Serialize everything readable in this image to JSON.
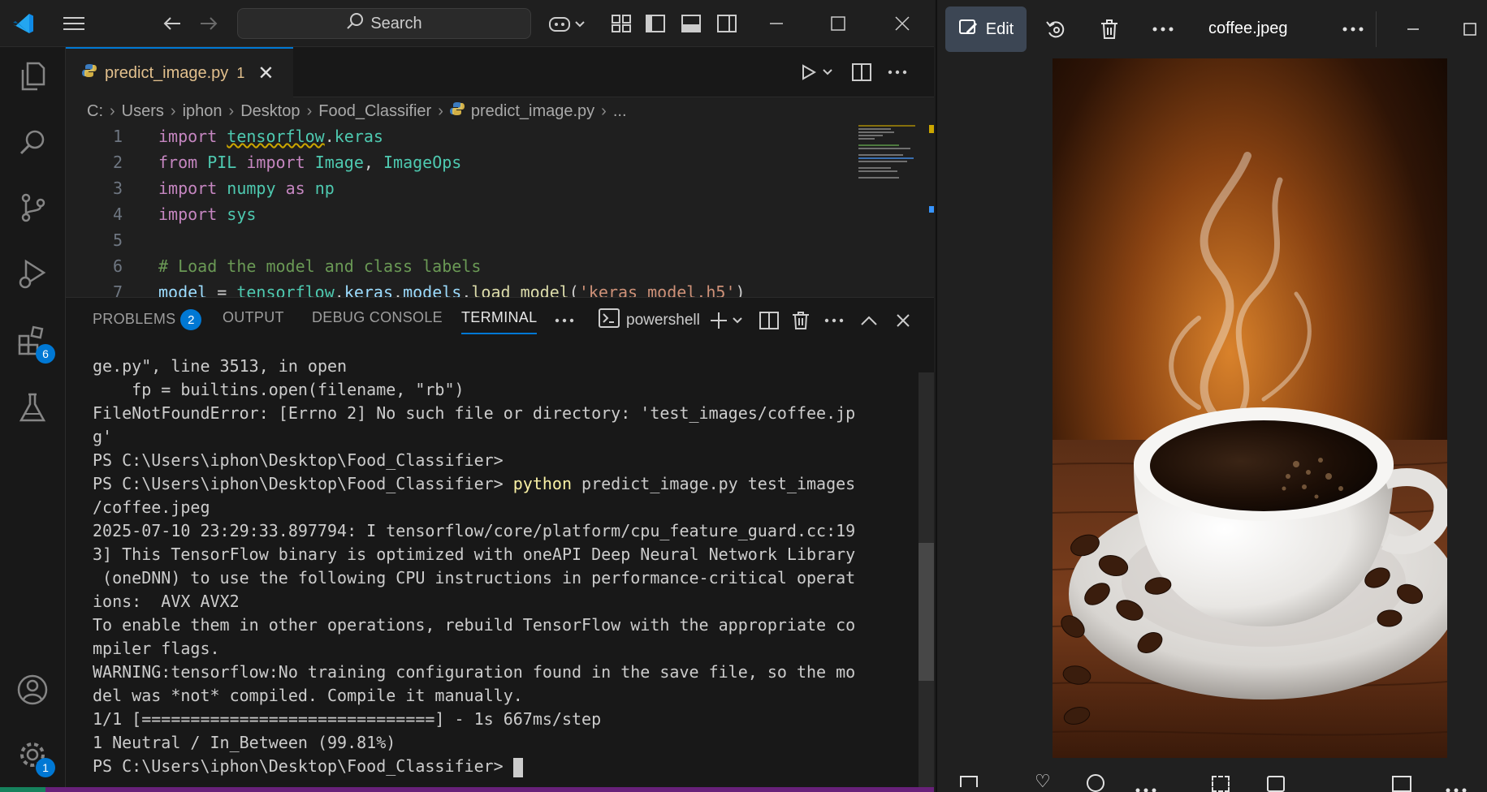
{
  "vscode": {
    "search_label": "Search",
    "tab": {
      "filename": "predict_image.py",
      "problem_count": "1"
    },
    "breadcrumb": [
      "C:",
      "Users",
      "iphon",
      "Desktop",
      "Food_Classifier",
      "predict_image.py",
      "..."
    ],
    "code_lines": [
      {
        "num": "1",
        "text": "import tensorflow.keras"
      },
      {
        "num": "2",
        "text": "from PIL import Image, ImageOps"
      },
      {
        "num": "3",
        "text": "import numpy as np"
      },
      {
        "num": "4",
        "text": "import sys"
      },
      {
        "num": "5",
        "text": ""
      },
      {
        "num": "6",
        "text": "# Load the model and class labels"
      },
      {
        "num": "7",
        "text": "model = tensorflow.keras.models.load_model('keras_model.h5')"
      }
    ],
    "activity_badges": {
      "extensions": "6",
      "settings": "1"
    },
    "panel": {
      "tabs": [
        "PROBLEMS",
        "OUTPUT",
        "DEBUG CONSOLE",
        "TERMINAL"
      ],
      "problems_count": "2",
      "shell_name": "powershell"
    },
    "terminal_lines": [
      "ge.py\", line 3513, in open",
      "    fp = builtins.open(filename, \"rb\")",
      "FileNotFoundError: [Errno 2] No such file or directory: 'test_images/coffee.jp",
      "g'",
      "PS C:\\Users\\iphon\\Desktop\\Food_Classifier>",
      "PS C:\\Users\\iphon\\Desktop\\Food_Classifier> ",
      "/coffee.jpeg",
      "2025-07-10 23:29:33.897794: I tensorflow/core/platform/cpu_feature_guard.cc:19",
      "3] This TensorFlow binary is optimized with oneAPI Deep Neural Network Library",
      " (oneDNN) to use the following CPU instructions in performance-critical operat",
      "ions:  AVX AVX2",
      "To enable them in other operations, rebuild TensorFlow with the appropriate co",
      "mpiler flags.",
      "WARNING:tensorflow:No training configuration found in the save file, so the mo",
      "del was *not* compiled. Compile it manually.",
      "1/1 [==============================] - 1s 667ms/step",
      "1 Neutral / In_Between (99.81%)",
      "PS C:\\Users\\iphon\\Desktop\\Food_Classifier> "
    ],
    "terminal_cmd_word": "python",
    "terminal_cmd_rest": " predict_image.py test_images"
  },
  "photos": {
    "edit_label": "Edit",
    "title": "coffee.jpeg"
  }
}
